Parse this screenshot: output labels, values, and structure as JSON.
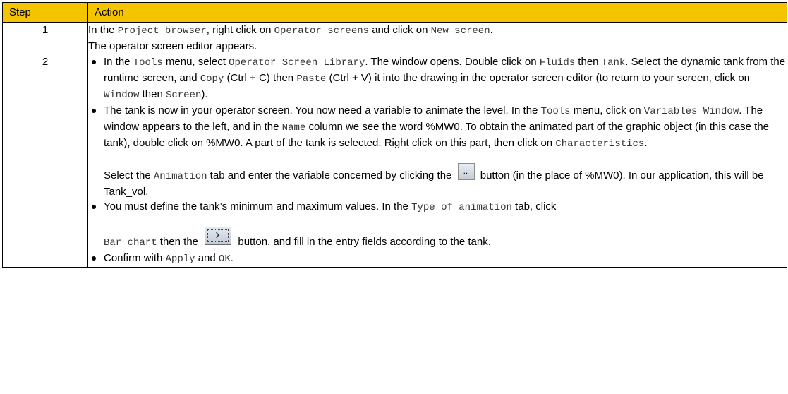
{
  "header": {
    "step": "Step",
    "action": "Action"
  },
  "row1": {
    "num": "1",
    "l1_a": "In the ",
    "l1_b": "Project browser",
    "l1_c": ", right click on ",
    "l1_d": "Operator screens",
    "l1_e": " and click on ",
    "l1_f": "New screen",
    "l1_g": ".",
    "l2": "The operator screen editor appears."
  },
  "row2": {
    "num": "2",
    "b1": {
      "t1": "In the ",
      "m1": "Tools",
      "t2": " menu, select ",
      "m2": "Operator Screen Library",
      "t3": ". The window opens. Double click on ",
      "m3": "Fluids",
      "t4": " then ",
      "m4": "Tank",
      "t5": ". Select the dynamic tank from the runtime screen, and ",
      "m5": "Copy",
      "t6": " (Ctrl + C) then ",
      "m6": "Paste",
      "t7": " (Ctrl + V) it into the drawing in the operator screen editor (to return to your screen, click on ",
      "m7": "Window",
      "t8": " then ",
      "m8": "Screen",
      "t9": ")."
    },
    "b2": {
      "t1": "The tank is now in your operator screen. You now need a variable to animate the level. In the ",
      "m1": "Tools",
      "t2": " menu, click on ",
      "m2": "Variables Window",
      "t3": ". The window appears to the left, and in the ",
      "m3": "Name",
      "t4": " column we see the word %MW0. To obtain the animated part of the graphic object (in this case the tank), double click on %MW0. A part of the tank is selected. Right click on this part, then click on ",
      "m4": "Characteristics",
      "t5": ".",
      "t6": "Select the ",
      "m5": "Animation",
      "t7": " tab and enter the variable concerned by clicking the ",
      "t8": " button (in the place of %MW0). In our application, this will be Tank_vol."
    },
    "b3": {
      "t1": "You must define the tank’s minimum and maximum values. In the ",
      "m1": "Type of animation",
      "t2": " tab, click ",
      "m2": "Bar chart",
      "t3": " then the ",
      "t4": " button, and fill in the entry fields according to the tank."
    },
    "b4": {
      "t1": "Confirm with ",
      "m1": "Apply",
      "t2": " and ",
      "m2": "OK",
      "t3": "."
    }
  }
}
